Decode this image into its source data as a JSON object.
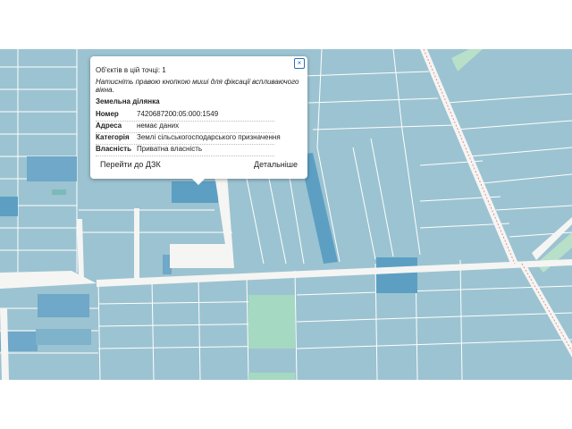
{
  "popup": {
    "objects_count": "Об'єктів в цій точці: 1",
    "hint": "Натисніть правою кнопкою миші для фіксації вспливаючого вікна.",
    "section_title": "Земельна ділянка",
    "close_symbol": "×",
    "rows": [
      {
        "key": "Номер",
        "value": "7420687200:05:000:1549"
      },
      {
        "key": "Адреса",
        "value": "немає даних"
      },
      {
        "key": "Категорія",
        "value": "Землі сільськогосподарського призначення"
      },
      {
        "key": "Власність",
        "value": "Приватна власність"
      }
    ],
    "buttons": {
      "goto_dzk": "Перейти до ДЗК",
      "details": "Детальніше"
    }
  },
  "colors": {
    "parcel": "#9cc3d1",
    "parcel_selected": "#5c9fc3",
    "parcel_green": "#a6d9c1",
    "road": "#f5f5f3",
    "outline": "#ffffff"
  }
}
